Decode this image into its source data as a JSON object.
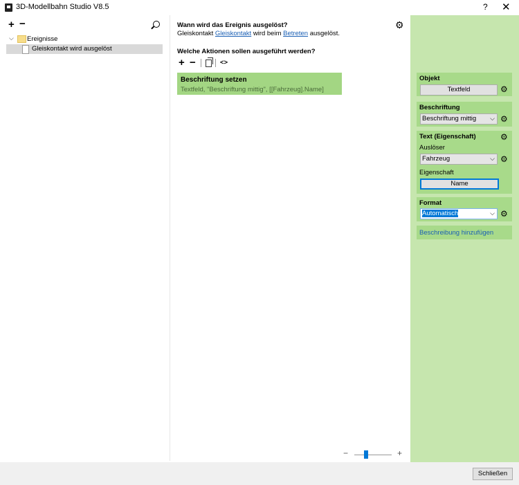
{
  "window": {
    "title": "3D-Modellbahn Studio V8.5",
    "help": "?",
    "close": "✕"
  },
  "left": {
    "add": "+",
    "remove": "−",
    "tree": {
      "root": "Ereignisse",
      "child": "Gleiskontakt wird ausgelöst"
    }
  },
  "center": {
    "heading1": "Wann wird das Ereignis ausgelöst?",
    "sentence": {
      "part1": "Gleiskontakt ",
      "link1": "Gleiskontakt",
      "part2": " wird beim ",
      "link2": "Betreten",
      "part3": " ausgelöst."
    },
    "heading2": "Welche Aktionen sollen ausgeführt werden?",
    "toolbar": {
      "add": "+",
      "remove": "−",
      "code": "<>"
    },
    "action": {
      "title": "Beschriftung setzen",
      "subtitle": "Textfeld, \"Beschriftung mittig\", [[Fahrzeug].Name]"
    },
    "zoom": {
      "minus": "−",
      "plus": "+",
      "level": 0.3
    }
  },
  "props": {
    "objekt": {
      "title": "Objekt",
      "value": "Textfeld"
    },
    "beschriftung": {
      "title": "Beschriftung",
      "value": "Beschriftung mittig"
    },
    "text": {
      "title": "Text (Eigenschaft)",
      "ausloeser_label": "Auslöser",
      "ausloeser_value": "Fahrzeug",
      "eigenschaft_label": "Eigenschaft",
      "eigenschaft_value": "Name"
    },
    "format": {
      "title": "Format",
      "value": "Automatisch"
    },
    "add_description": "Beschreibung hinzufügen"
  },
  "footer": {
    "close_label": "Schließen"
  },
  "colors": {
    "accent": "#0078d7",
    "panel_bg": "#c6e6ae",
    "section_bg": "#a8da8a",
    "action_bg": "#a3d683",
    "link": "#1a5fb4"
  }
}
